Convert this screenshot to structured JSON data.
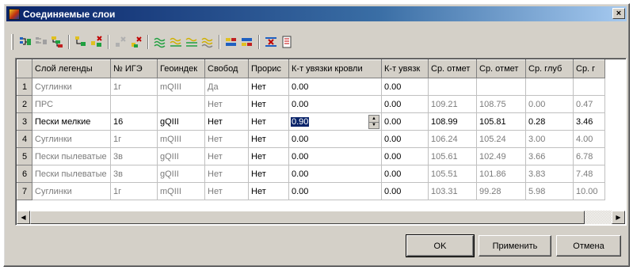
{
  "window": {
    "title": "Соединяемые слои",
    "close_label": "×"
  },
  "toolbar": {
    "icons": [
      "link-layers-icon",
      "unlink-layers-icon",
      "merge-layers-icon",
      "add-child-icon",
      "remove-child-icon",
      "delete-disabled-icon",
      "delete-icon",
      "wave-green-icon",
      "wave-yellow-icon",
      "wave-yellow2-icon",
      "wave-gray-icon",
      "move-up-icon",
      "move-down-icon",
      "clear-filter-icon",
      "report-icon"
    ]
  },
  "grid": {
    "columns": [
      "Слой легенды",
      "№ ИГЭ",
      "Геоиндек",
      "Свобод",
      "Прорис",
      "К-т увязки кровли",
      "К-т увязк",
      "Ср. отмет",
      "Ср. отмет",
      "Ср. глуб",
      "Ср. г"
    ],
    "rows": [
      {
        "num": "1",
        "cells": [
          "Суглинки",
          "1г",
          "mQIII",
          "Да",
          "Нет",
          "0.00",
          "0.00",
          "",
          "",
          "",
          ""
        ]
      },
      {
        "num": "2",
        "cells": [
          "ПРС",
          "",
          "",
          "Нет",
          "Нет",
          "0.00",
          "0.00",
          "109.21",
          "108.75",
          "0.00",
          "0.47"
        ]
      },
      {
        "num": "3",
        "cells": [
          "Пески мелкие",
          "16",
          "gQIII",
          "Нет",
          "Нет",
          "0.90",
          "0.00",
          "108.99",
          "105.81",
          "0.28",
          "3.46"
        ]
      },
      {
        "num": "4",
        "cells": [
          "Суглинки",
          "1г",
          "mQIII",
          "Нет",
          "Нет",
          "0.00",
          "0.00",
          "106.24",
          "105.24",
          "3.00",
          "4.00"
        ]
      },
      {
        "num": "5",
        "cells": [
          "Пески пылеватые",
          "3в",
          "gQIII",
          "Нет",
          "Нет",
          "0.00",
          "0.00",
          "105.61",
          "102.49",
          "3.66",
          "6.78"
        ]
      },
      {
        "num": "6",
        "cells": [
          "Пески пылеватые",
          "3в",
          "gQIII",
          "Нет",
          "Нет",
          "0.00",
          "0.00",
          "105.51",
          "101.86",
          "3.83",
          "7.48"
        ]
      },
      {
        "num": "7",
        "cells": [
          "Суглинки",
          "1г",
          "mQIII",
          "Нет",
          "Нет",
          "0.00",
          "0.00",
          "103.31",
          "99.28",
          "5.98",
          "10.00"
        ]
      }
    ]
  },
  "scrollbar": {
    "left_arrow": "◀",
    "right_arrow": "▶"
  },
  "buttons": {
    "ok": "OK",
    "apply": "Применить",
    "cancel": "Отмена"
  },
  "colors": {
    "title_bar_start": "#0a246a",
    "title_bar_end": "#a6caf0",
    "dialog_face": "#d4d0c8",
    "inactive_text": "#7b7b7b",
    "selection": "#0a246a"
  }
}
